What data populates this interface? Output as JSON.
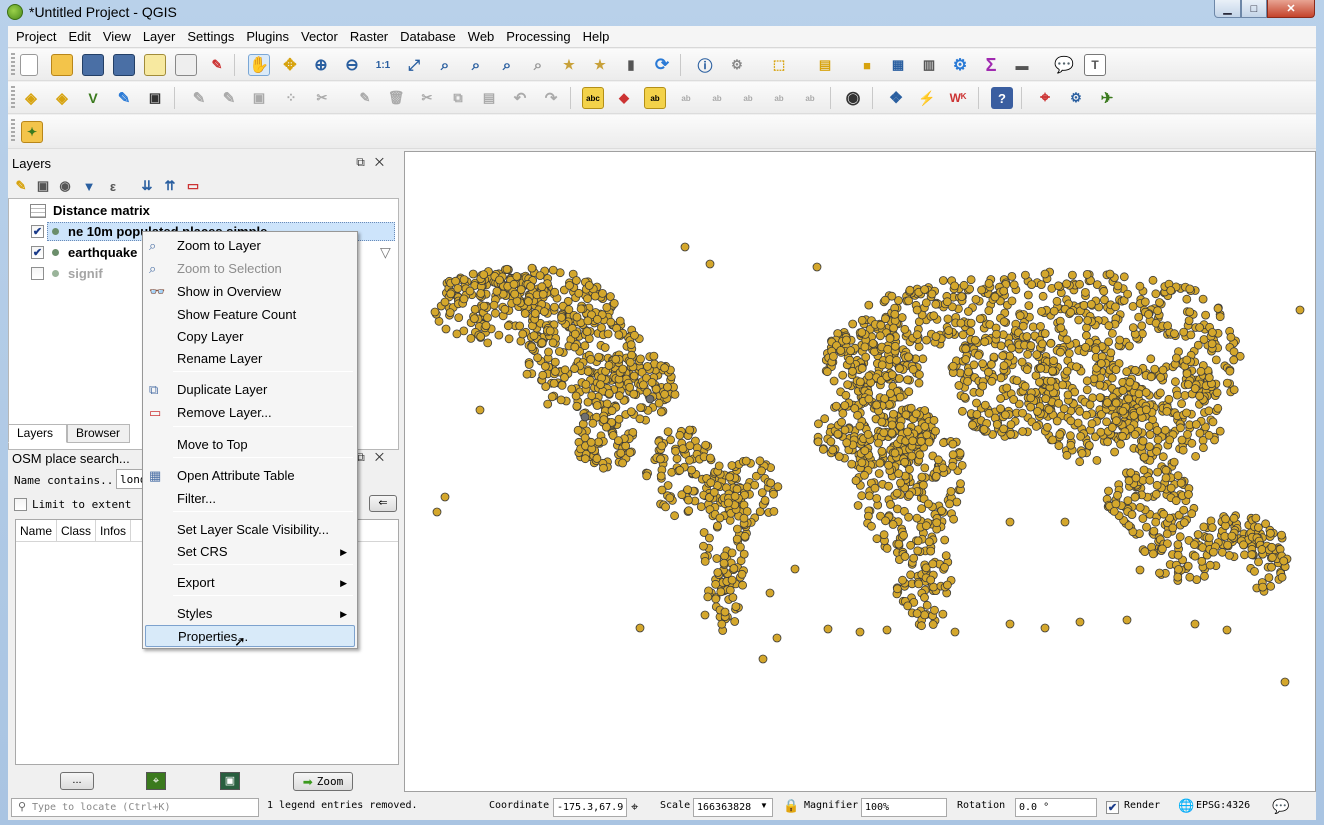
{
  "window": {
    "title": "*Untitled Project - QGIS"
  },
  "menubar": [
    "Project",
    "Edit",
    "View",
    "Layer",
    "Settings",
    "Plugins",
    "Vector",
    "Raster",
    "Database",
    "Web",
    "Processing",
    "Help"
  ],
  "layers_panel": {
    "title": "Layers",
    "layers": [
      {
        "name": "Distance matrix",
        "checked": null
      },
      {
        "name": "ne 10m populated places simple",
        "checked": true
      },
      {
        "name": "earthquake",
        "checked": true
      },
      {
        "name": "signif",
        "checked": false
      }
    ],
    "tabs": [
      "Layers",
      "Browser"
    ]
  },
  "osm_panel": {
    "title": "OSM place search...",
    "name_label": "Name contains...",
    "name_value": "lond",
    "limit_label": "Limit to extent",
    "columns": [
      "Name",
      "Class",
      "Infos"
    ],
    "dots_label": "...",
    "zoom_label": "Zoom"
  },
  "context_menu": {
    "items": [
      {
        "label": "Zoom to Layer",
        "enabled": true,
        "icon": "zoom-layer-icon"
      },
      {
        "label": "Zoom to Selection",
        "enabled": false,
        "icon": "zoom-selection-icon"
      },
      {
        "label": "Show in Overview",
        "enabled": true,
        "icon": "overview-icon"
      },
      {
        "label": "Show Feature Count",
        "enabled": true
      },
      {
        "label": "Copy Layer",
        "enabled": true
      },
      {
        "label": "Rename Layer",
        "enabled": true
      },
      {
        "label": "Duplicate Layer",
        "enabled": true,
        "icon": "duplicate-icon"
      },
      {
        "label": "Remove Layer...",
        "enabled": true,
        "icon": "remove-layer-icon"
      },
      {
        "label": "Move to Top",
        "enabled": true
      },
      {
        "label": "Open Attribute Table",
        "enabled": true,
        "icon": "attribute-table-icon"
      },
      {
        "label": "Filter...",
        "enabled": true
      },
      {
        "label": "Set Layer Scale Visibility...",
        "enabled": true
      },
      {
        "label": "Set CRS",
        "enabled": true,
        "submenu": true
      },
      {
        "label": "Export",
        "enabled": true,
        "submenu": true
      },
      {
        "label": "Styles",
        "enabled": true,
        "submenu": true
      },
      {
        "label": "Properties...",
        "enabled": true,
        "hovered": true
      }
    ]
  },
  "statusbar": {
    "locator_placeholder": "Type to locate (Ctrl+K)",
    "message": "1 legend entries removed.",
    "coordinate_label": "Coordinate",
    "coordinate_value": "-175.3,67.9",
    "scale_label": "Scale",
    "scale_value": "166363828",
    "magnifier_label": "Magnifier",
    "magnifier_value": "100%",
    "rotation_label": "Rotation",
    "rotation_value": "0.0 °",
    "render_label": "Render",
    "crs": "EPSG:4326"
  },
  "colors": {
    "point_fill": "#d4a72c",
    "point_stroke": "#3a3a3a",
    "selected_layer_bg": "#cde4fb",
    "menu_hover": "#d8eaf9"
  }
}
